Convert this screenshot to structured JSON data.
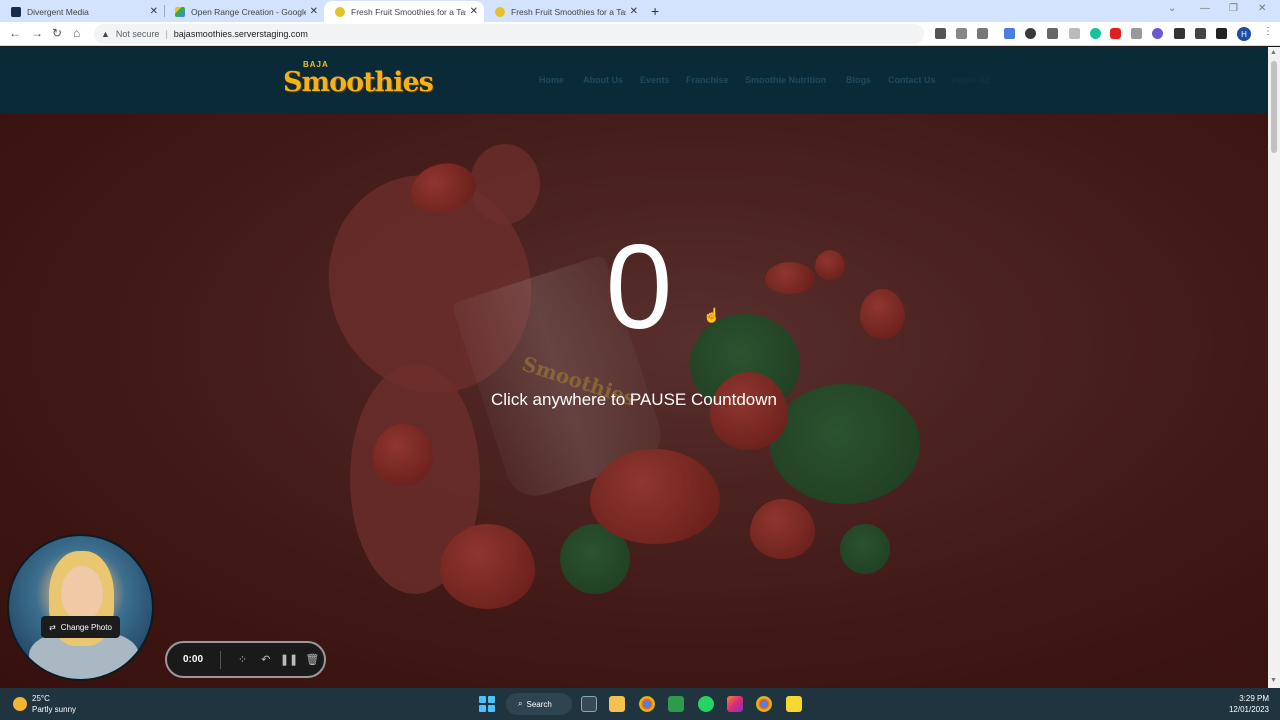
{
  "browser": {
    "tabs": [
      {
        "title": "Divergent Media",
        "active": false
      },
      {
        "title": "Open Range Creation - Google D",
        "active": false
      },
      {
        "title": "Fresh Fruit Smoothies for a Tasty",
        "active": true
      },
      {
        "title": "Fresh Fruit Smoothies for a Tasty",
        "active": false
      }
    ],
    "new_tab": "+",
    "security_label": "Not secure",
    "url": "bajasmoothies.serverstaging.com",
    "profile_initial": "H"
  },
  "site": {
    "logo_top": "BAJA",
    "logo_main": "Smoothies",
    "menu": [
      "Home",
      "About Us",
      "Events",
      "Franchise",
      "Smoothie Nutrition",
      "Blogs",
      "Contact Us",
      "Home #2"
    ],
    "cup_logo": "Smoothies"
  },
  "overlay": {
    "countdown": "0",
    "message": "Click anywhere to PAUSE Countdown"
  },
  "recorder": {
    "change_photo": "Change Photo",
    "time": "0:00"
  },
  "taskbar": {
    "temp": "25°C",
    "weather": "Partly sunny",
    "search": "Search",
    "time": "3:29 PM",
    "date": "12/01/2023"
  },
  "colors": {
    "header_bg": "#0a2a38",
    "logo": "#f4b21a",
    "menu_text": "#1f4a5c",
    "hero_bg": "#4a1a16"
  }
}
